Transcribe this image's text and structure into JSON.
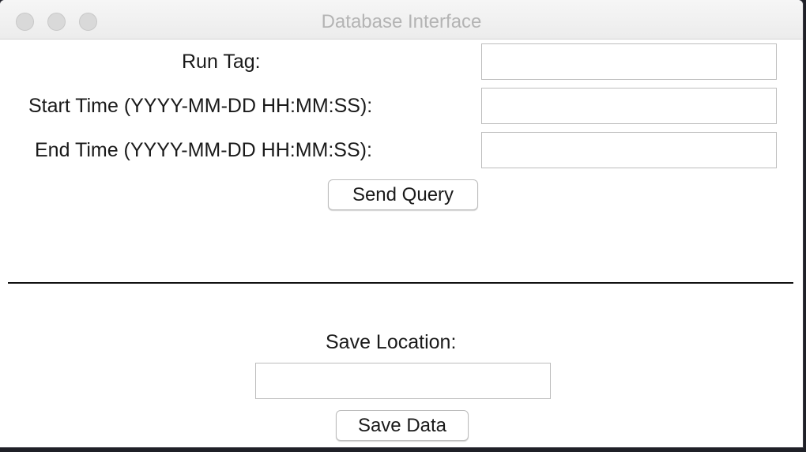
{
  "window": {
    "title": "Database Interface"
  },
  "query_form": {
    "run_tag_label": "Run Tag:",
    "run_tag_value": "",
    "start_time_label": "Start Time (YYYY-MM-DD HH:MM:SS):",
    "start_time_value": "",
    "end_time_label": "End Time (YYYY-MM-DD HH:MM:SS):",
    "end_time_value": "",
    "send_query_label": "Send Query"
  },
  "save_form": {
    "save_location_label": "Save Location:",
    "save_location_value": "",
    "save_data_label": "Save Data"
  }
}
